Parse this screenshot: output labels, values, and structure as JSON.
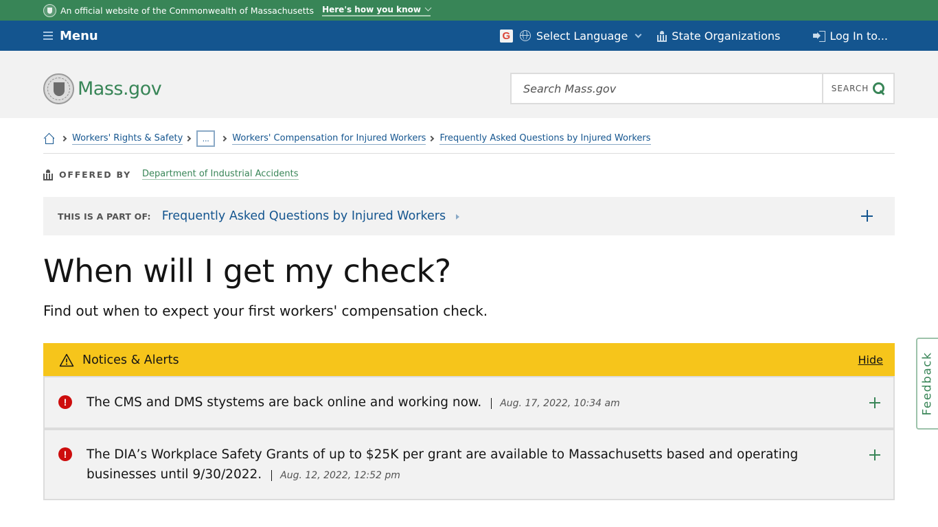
{
  "official_banner": {
    "text": "An official website of the Commonwealth of Massachusetts",
    "how_you_know": "Here's how you know"
  },
  "nav": {
    "menu_label": "Menu",
    "select_language": "Select Language",
    "state_organizations": "State Organizations",
    "log_in": "Log In to..."
  },
  "header": {
    "logo_text": "Mass.gov",
    "search_placeholder": "Search Mass.gov",
    "search_button": "SEARCH"
  },
  "breadcrumb": {
    "items": [
      {
        "label": "Workers' Rights & Safety"
      },
      {
        "label": "..."
      },
      {
        "label": "Workers' Compensation for Injured Workers"
      },
      {
        "label": "Frequently Asked Questions by Injured Workers"
      }
    ]
  },
  "offered_by": {
    "label": "OFFERED BY",
    "organization": "Department of Industrial Accidents"
  },
  "part_of": {
    "label": "THIS IS A PART OF:",
    "link": "Frequently Asked Questions by Injured Workers"
  },
  "page": {
    "title": "When will I get my check?",
    "subtitle": "Find out when to expect your first workers' compensation check."
  },
  "alerts": {
    "title": "Notices & Alerts",
    "hide_label": "Hide",
    "items": [
      {
        "text": "The CMS and DMS stystems are back online and working now.",
        "date": "Aug. 17, 2022, 10:34 am"
      },
      {
        "text": "The DIA’s Workplace Safety Grants of up to $25K per grant are available to Massachusetts based and operating businesses until 9/30/2022.",
        "date": "Aug. 12, 2022, 12:52 pm"
      }
    ]
  },
  "feedback": {
    "label": "Feedback"
  },
  "colors": {
    "brand_green": "#388557",
    "brand_blue": "#14558f",
    "alert_yellow": "#f6c51b",
    "alert_red": "#cd0d0d",
    "header_gray": "#f2f2f2"
  }
}
